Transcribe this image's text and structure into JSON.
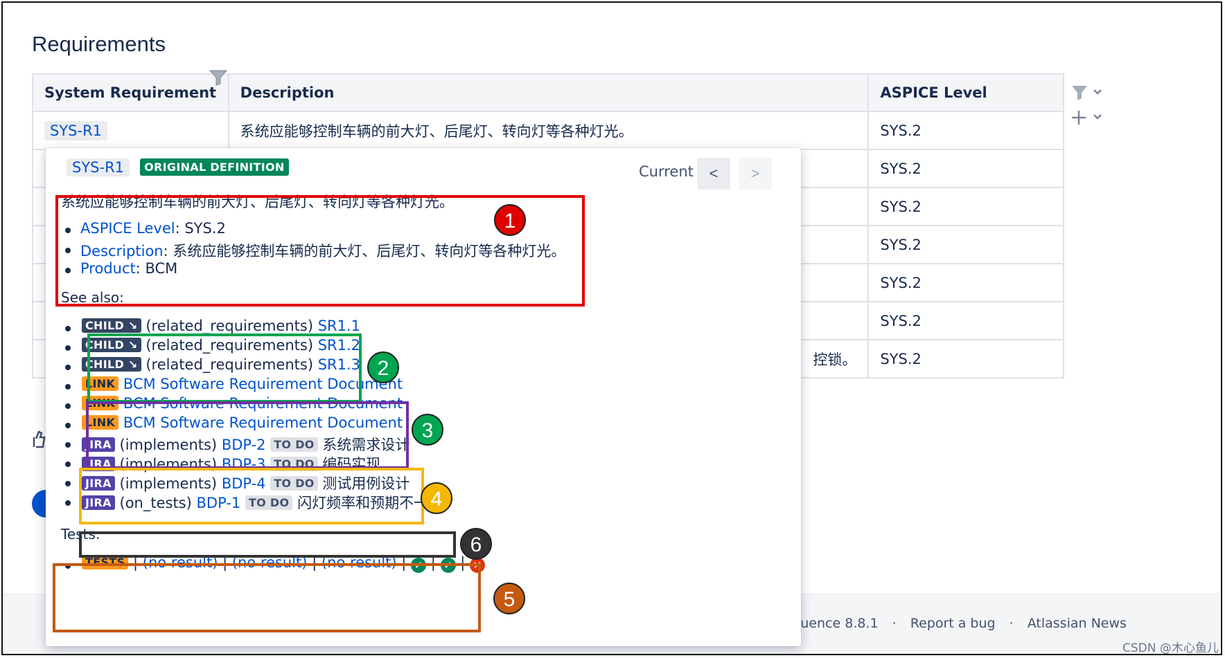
{
  "page": {
    "title": "Requirements"
  },
  "table": {
    "headers": [
      "System Requirement",
      "Description",
      "ASPICE Level"
    ],
    "rows": [
      {
        "req": "SYS-R1",
        "desc": "系统应能够控制车辆的前大灯、后尾灯、转向灯等各种灯光。",
        "level": "SYS.2"
      },
      {
        "req": "",
        "desc": "",
        "level": "SYS.2"
      },
      {
        "req": "",
        "desc": "",
        "level": "SYS.2"
      },
      {
        "req": "",
        "desc": "",
        "level": "SYS.2"
      },
      {
        "req": "",
        "desc": "",
        "level": "SYS.2"
      },
      {
        "req": "",
        "desc": "",
        "level": "SYS.2"
      },
      {
        "req": "",
        "desc": "控锁。",
        "level": "SYS.2"
      }
    ]
  },
  "side_tools": {
    "filter_icon": "filter-icon",
    "add_icon": "+",
    "chevron": "⌄"
  },
  "popup": {
    "key": "SYS-R1",
    "badge": "ORIGINAL DEFINITION",
    "current_label": "Current",
    "prev": "<",
    "next": ">",
    "description": "系统应能够控制车辆的前大灯、后尾灯、转向灯等各种灯光。",
    "properties": [
      {
        "name": "ASPICE Level",
        "value": ": SYS.2"
      },
      {
        "name": "Description",
        "value": ": 系统应能够控制车辆的前大灯、后尾灯、转向灯等各种灯光。"
      },
      {
        "name": "Product",
        "value": ": BCM"
      }
    ],
    "see_also_label": "See also:",
    "child_rel": [
      {
        "lozenge": "CHILD ↘",
        "rel": "(related_requirements)",
        "target": "SR1.1"
      },
      {
        "lozenge": "CHILD ↘",
        "rel": "(related_requirements)",
        "target": "SR1.2"
      },
      {
        "lozenge": "CHILD ↘",
        "rel": "(related_requirements)",
        "target": "SR1.3"
      }
    ],
    "link_rel": [
      {
        "lozenge": "LINK",
        "target": "BCM Software Requirement Document"
      },
      {
        "lozenge": "LINK",
        "target": "BCM Software Requirement Document"
      },
      {
        "lozenge": "LINK",
        "target": "BCM Software Requirement Document"
      }
    ],
    "jira_rel": [
      {
        "lozenge": "JIRA",
        "rel": "(implements)",
        "key": "BDP-2",
        "status": "TO DO",
        "summary": "系统需求设计"
      },
      {
        "lozenge": "JIRA",
        "rel": "(implements)",
        "key": "BDP-3",
        "status": "TO DO",
        "summary": "编码实现"
      },
      {
        "lozenge": "JIRA",
        "rel": "(implements)",
        "key": "BDP-4",
        "status": "TO DO",
        "summary": "测试用例设计"
      },
      {
        "lozenge": "JIRA",
        "rel": "(on_tests)",
        "key": "BDP-1",
        "status": "TO DO",
        "summary": "闪灯频率和预期不一致"
      }
    ],
    "tests_label": "Tests:",
    "tests": {
      "lozenge": "TESTS",
      "sep": "|",
      "results": [
        "(no result)",
        "(no result)",
        "(no result)"
      ],
      "pass_symbol": "✓",
      "fail_symbol": "✕"
    }
  },
  "annotations": {
    "labels": [
      "1",
      "2",
      "3",
      "4",
      "5",
      "6"
    ],
    "colors": {
      "1": "#e00000",
      "2": "#00a550",
      "3": "#7030a0",
      "4": "#f5b800",
      "5": "#c55a11",
      "6": "#333333"
    }
  },
  "footer": {
    "items": [
      "luence 8.8.1",
      "·",
      "Report a bug",
      "·",
      "Atlassian News"
    ]
  },
  "watermark": "CSDN @木心鱼儿"
}
